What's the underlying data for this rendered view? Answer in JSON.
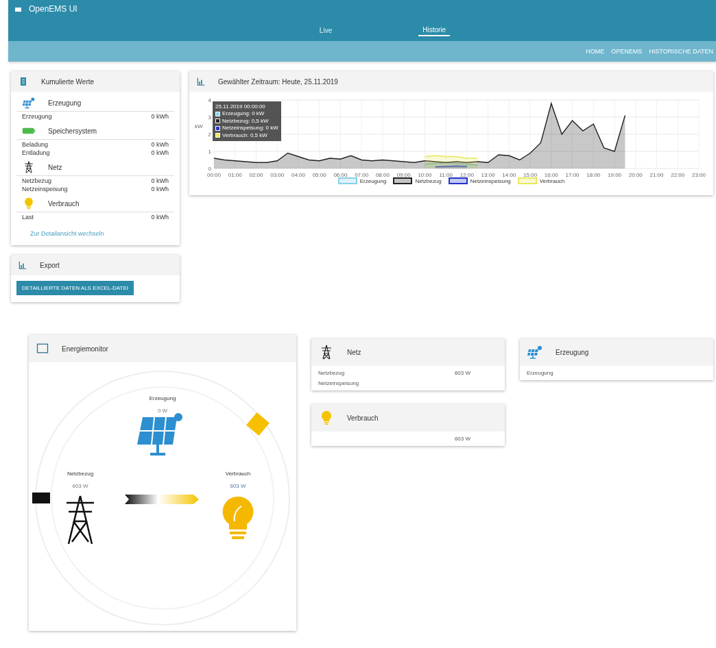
{
  "app": {
    "title": "OpenEMS UI"
  },
  "tabs": [
    {
      "label": "Live",
      "selected": false
    },
    {
      "label": "Historie",
      "selected": true
    }
  ],
  "breadcrumbs": [
    "HOME",
    "OPENEMS",
    "HISTORISCHE DATEN"
  ],
  "cumulated": {
    "title": "Kumulierte Werte",
    "sections": [
      {
        "kind": "production",
        "title": "Erzeugung",
        "rows": [
          {
            "label": "Erzeugung",
            "value": "0 kWh"
          }
        ]
      },
      {
        "kind": "storage",
        "title": "Speichersystem",
        "rows": [
          {
            "label": "Beladung",
            "value": "0 kWh"
          },
          {
            "label": "Entladung",
            "value": "0 kWh"
          }
        ]
      },
      {
        "kind": "grid",
        "title": "Netz",
        "rows": [
          {
            "label": "Netzbezug",
            "value": "0 kWh"
          },
          {
            "label": "Netzeinspeisung",
            "value": "0 kWh"
          }
        ]
      },
      {
        "kind": "consumption",
        "title": "Verbrauch",
        "rows": [
          {
            "label": "Last",
            "value": "0 kWh"
          }
        ]
      }
    ],
    "link": "Zur Detailansicht wechseln"
  },
  "export": {
    "title": "Export",
    "button": "DETAILLIERTE DATEN ALS EXCEL-DATEI"
  },
  "chart_card": {
    "title": "Gewählter Zeitraum: Heute, 25.11.2019",
    "tooltip": {
      "title": "25.11.2019 00:00:00",
      "lines": [
        "Erzeugung: 0 kW",
        "Netzbezug: 0,5 kW",
        "Netzeinspeisung: 0 kW",
        "Verbrauch: 0,5 kW"
      ]
    },
    "chart_data": {
      "type": "area",
      "grid": true,
      "legend": true,
      "ylabel": "kW",
      "ylim": [
        0,
        4
      ],
      "yticks": [
        0,
        1,
        2,
        3,
        4
      ],
      "xlim": [
        0,
        23
      ],
      "xticks": [
        {
          "value": 0,
          "label": "00:00"
        },
        {
          "value": 1,
          "label": "01:00"
        },
        {
          "value": 2,
          "label": "02:00"
        },
        {
          "value": 3,
          "label": "03:00"
        },
        {
          "value": 4,
          "label": "04:00"
        },
        {
          "value": 5,
          "label": "05:00"
        },
        {
          "value": 6,
          "label": "06:00"
        },
        {
          "value": 7,
          "label": "07:00"
        },
        {
          "value": 8,
          "label": "08:00"
        },
        {
          "value": 9,
          "label": "09:00"
        },
        {
          "value": 10,
          "label": "10:00"
        },
        {
          "value": 11,
          "label": "11:00"
        },
        {
          "value": 12,
          "label": "12:00"
        },
        {
          "value": 13,
          "label": "13:00"
        },
        {
          "value": 14,
          "label": "14:00"
        },
        {
          "value": 15,
          "label": "15:00"
        },
        {
          "value": 16,
          "label": "16:00"
        },
        {
          "value": 17,
          "label": "17:00"
        },
        {
          "value": 18,
          "label": "18:00"
        },
        {
          "value": 19,
          "label": "19:00"
        },
        {
          "value": 20,
          "label": "20:00"
        },
        {
          "value": 21,
          "label": "21:00"
        },
        {
          "value": 22,
          "label": "22:00"
        },
        {
          "value": 23,
          "label": "23:00"
        }
      ],
      "x": [
        0,
        0.5,
        1,
        1.5,
        2,
        2.5,
        3,
        3.5,
        4,
        4.5,
        5,
        5.5,
        6,
        6.5,
        7,
        7.5,
        8,
        8.5,
        9,
        9.5,
        10,
        10.5,
        11,
        11.5,
        12,
        12.5,
        13,
        13.5,
        14,
        14.5,
        15,
        15.5,
        16,
        16.5,
        17,
        17.5,
        18,
        18.5,
        19,
        19.5
      ],
      "series": [
        {
          "name": "Erzeugung",
          "color": "#86d2e8",
          "values": [
            null,
            null,
            null,
            null,
            null,
            null,
            null,
            null,
            null,
            null,
            null,
            null,
            null,
            null,
            null,
            null,
            null,
            null,
            null,
            null,
            0.25,
            0.3,
            0.35,
            0.3,
            0.25,
            0.2,
            null,
            null,
            null,
            null,
            null,
            null,
            null,
            null,
            null,
            null,
            null,
            null,
            null,
            null
          ]
        },
        {
          "name": "Netzbezug",
          "color": "#222222",
          "values": [
            0.6,
            0.5,
            0.45,
            0.4,
            0.35,
            0.35,
            0.45,
            0.9,
            0.7,
            0.5,
            0.45,
            0.6,
            0.55,
            0.75,
            0.5,
            0.45,
            0.5,
            0.45,
            0.4,
            0.35,
            0.45,
            0.4,
            0.35,
            0.4,
            0.35,
            0.4,
            0.35,
            0.8,
            0.75,
            0.5,
            0.9,
            1.5,
            3.8,
            2.0,
            2.8,
            2.2,
            2.6,
            1.2,
            1.0,
            3.1
          ]
        },
        {
          "name": "Netzeinspeisung",
          "color": "#2233cc",
          "values": [
            null,
            null,
            null,
            null,
            null,
            null,
            null,
            null,
            null,
            null,
            null,
            null,
            null,
            null,
            null,
            null,
            null,
            null,
            null,
            null,
            null,
            0.1,
            0.12,
            0.15,
            0.12,
            null,
            null,
            null,
            null,
            null,
            null,
            null,
            null,
            null,
            null,
            null,
            null,
            null,
            null,
            null
          ]
        },
        {
          "name": "Verbrauch",
          "color": "#e8e85a",
          "values": [
            null,
            null,
            null,
            null,
            null,
            null,
            null,
            null,
            null,
            null,
            null,
            null,
            null,
            null,
            null,
            null,
            null,
            null,
            null,
            null,
            0.7,
            0.75,
            0.7,
            0.7,
            0.6,
            0.6,
            null,
            null,
            null,
            null,
            null,
            null,
            null,
            null,
            null,
            null,
            null,
            null,
            null,
            null
          ]
        }
      ]
    }
  },
  "energy_monitor": {
    "title": "Energiemonitor",
    "nodes": [
      {
        "kind": "production",
        "label": "Erzeugung",
        "value": "0 W"
      },
      {
        "kind": "grid",
        "label": "Netzbezug",
        "value": "603 W"
      },
      {
        "kind": "consumption",
        "label": "Verbrauch",
        "value": "603 W"
      }
    ]
  },
  "widgets": [
    {
      "kind": "grid",
      "title": "Netz",
      "rows": [
        {
          "label": "Netzbezug",
          "value": "603 W"
        },
        {
          "label": "Netzeinspeisung"
        }
      ]
    },
    {
      "kind": "production",
      "title": "Erzeugung",
      "rows": [
        {
          "label": "Erzeugung"
        }
      ]
    },
    {
      "kind": "consumption",
      "title": "Verbrauch",
      "rows": [
        {
          "value": "603 W"
        }
      ]
    }
  ]
}
